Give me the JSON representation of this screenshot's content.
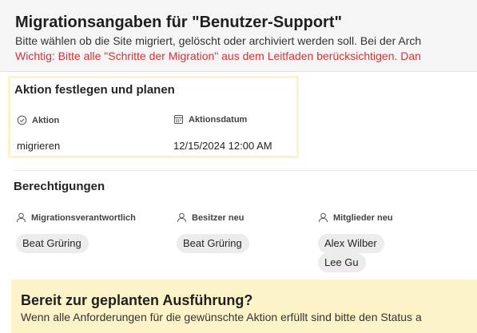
{
  "header": {
    "title": "Migrationsangaben für \"Benutzer-Support\"",
    "description": "Bitte wählen ob die Site migriert, gelöscht oder archiviert werden soll. Bei der Arch",
    "warning": "Wichtig: Bitte alle \"Schritte der Migration\" aus dem Leitfaden berücksichtigen. Dan"
  },
  "action_section": {
    "title": "Aktion festlegen und planen",
    "action_label": "Aktion",
    "action_value": "migrieren",
    "date_label": "Aktionsdatum",
    "date_value": "12/15/2024 12:00 AM"
  },
  "permissions": {
    "title": "Berechtigungen",
    "migration_owner_label": "Migrationsverantwortlich",
    "migration_owner_people": [
      "Beat Grüring"
    ],
    "new_owner_label": "Besitzer neu",
    "new_owner_people": [
      "Beat Grüring"
    ],
    "new_members_label": "Mitglieder neu",
    "new_members_people": [
      "Alex Wilber",
      "Lee Gu"
    ]
  },
  "ready_banner": {
    "title": "Bereit zur geplanten Ausführung?",
    "text": "Wenn alle Anforderungen für die gewünschte Aktion erfüllt sind bitte den Status a"
  },
  "colors": {
    "warning": "#d13438",
    "highlight": "#fdf3c9",
    "header_bg": "#f5f5f5",
    "chip_bg": "#ececec"
  }
}
